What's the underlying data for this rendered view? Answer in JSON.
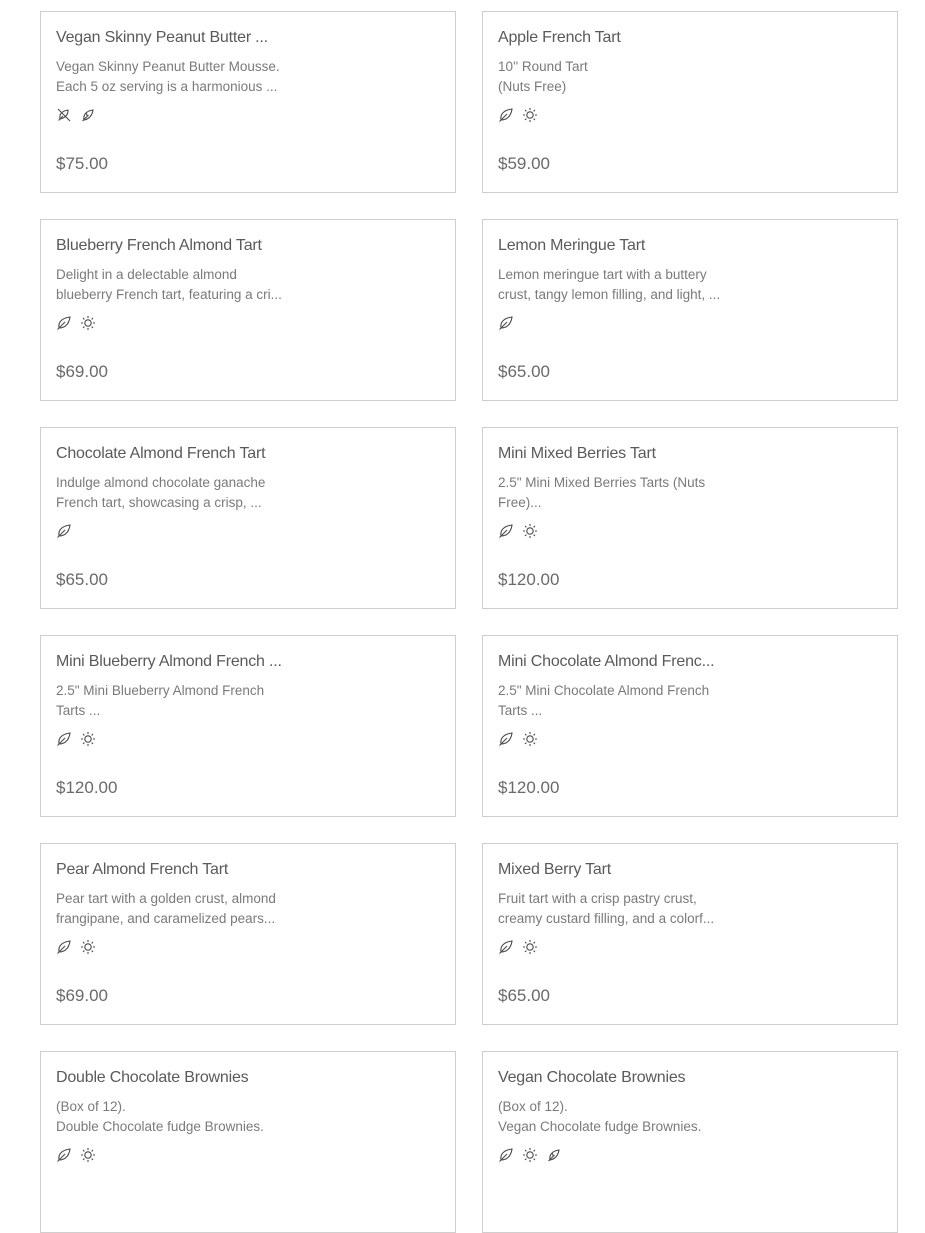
{
  "products": [
    {
      "title": "Vegan Skinny Peanut Butter ...",
      "desc_line1": "Vegan Skinny Peanut Butter Mousse.",
      "desc_line2": "Each 5 oz serving is a harmonious ...",
      "icons": [
        "no-nuts-icon",
        "vegan-leaf-icon"
      ],
      "price": "$75.00"
    },
    {
      "title": "Apple French Tart",
      "desc_line1": "10'' Round Tart",
      "desc_line2": "(Nuts Free)",
      "icons": [
        "leaf-icon",
        "sun-icon"
      ],
      "price": "$59.00"
    },
    {
      "title": "Blueberry French Almond Tart",
      "desc_line1": "Delight in a delectable almond",
      "desc_line2": "blueberry French tart, featuring a cri...",
      "icons": [
        "leaf-icon",
        "sun-icon"
      ],
      "price": "$69.00"
    },
    {
      "title": "Lemon Meringue Tart",
      "desc_line1": "Lemon meringue tart with a buttery",
      "desc_line2": "crust, tangy lemon filling, and light, ...",
      "icons": [
        "leaf-icon"
      ],
      "price": "$65.00"
    },
    {
      "title": "Chocolate Almond French Tart",
      "desc_line1": "Indulge almond chocolate ganache",
      "desc_line2": "French tart, showcasing a crisp, ...",
      "icons": [
        "leaf-icon"
      ],
      "price": "$65.00"
    },
    {
      "title": "Mini Mixed Berries Tart",
      "desc_line1": "2.5\" Mini Mixed Berries Tarts (Nuts",
      "desc_line2": "Free)...",
      "icons": [
        "leaf-icon",
        "sun-icon"
      ],
      "price": "$120.00"
    },
    {
      "title": "Mini Blueberry Almond French ...",
      "desc_line1": "2.5\" Mini Blueberry Almond French",
      "desc_line2": "Tarts ...",
      "icons": [
        "leaf-icon",
        "sun-icon"
      ],
      "price": "$120.00"
    },
    {
      "title": "Mini Chocolate Almond Frenc...",
      "desc_line1": "2.5\" Mini Chocolate Almond French",
      "desc_line2": "Tarts ...",
      "icons": [
        "leaf-icon",
        "sun-icon"
      ],
      "price": "$120.00"
    },
    {
      "title": "Pear Almond French Tart",
      "desc_line1": "Pear tart with a golden crust, almond",
      "desc_line2": "frangipane, and caramelized pears...",
      "icons": [
        "leaf-icon",
        "sun-icon"
      ],
      "price": "$69.00"
    },
    {
      "title": "Mixed Berry Tart",
      "desc_line1": "Fruit tart with a crisp pastry crust,",
      "desc_line2": "creamy custard filling, and a colorf...",
      "icons": [
        "leaf-icon",
        "sun-icon"
      ],
      "price": "$65.00"
    },
    {
      "title": "Double Chocolate Brownies",
      "desc_line1": "(Box of 12).",
      "desc_line2": "Double Chocolate fudge Brownies.",
      "icons": [
        "leaf-icon",
        "sun-icon"
      ],
      "price": ""
    },
    {
      "title": "Vegan Chocolate Brownies",
      "desc_line1": "(Box of 12).",
      "desc_line2": "Vegan Chocolate fudge Brownies.",
      "icons": [
        "leaf-icon",
        "sun-icon",
        "vegan-leaf-icon"
      ],
      "price": ""
    }
  ]
}
